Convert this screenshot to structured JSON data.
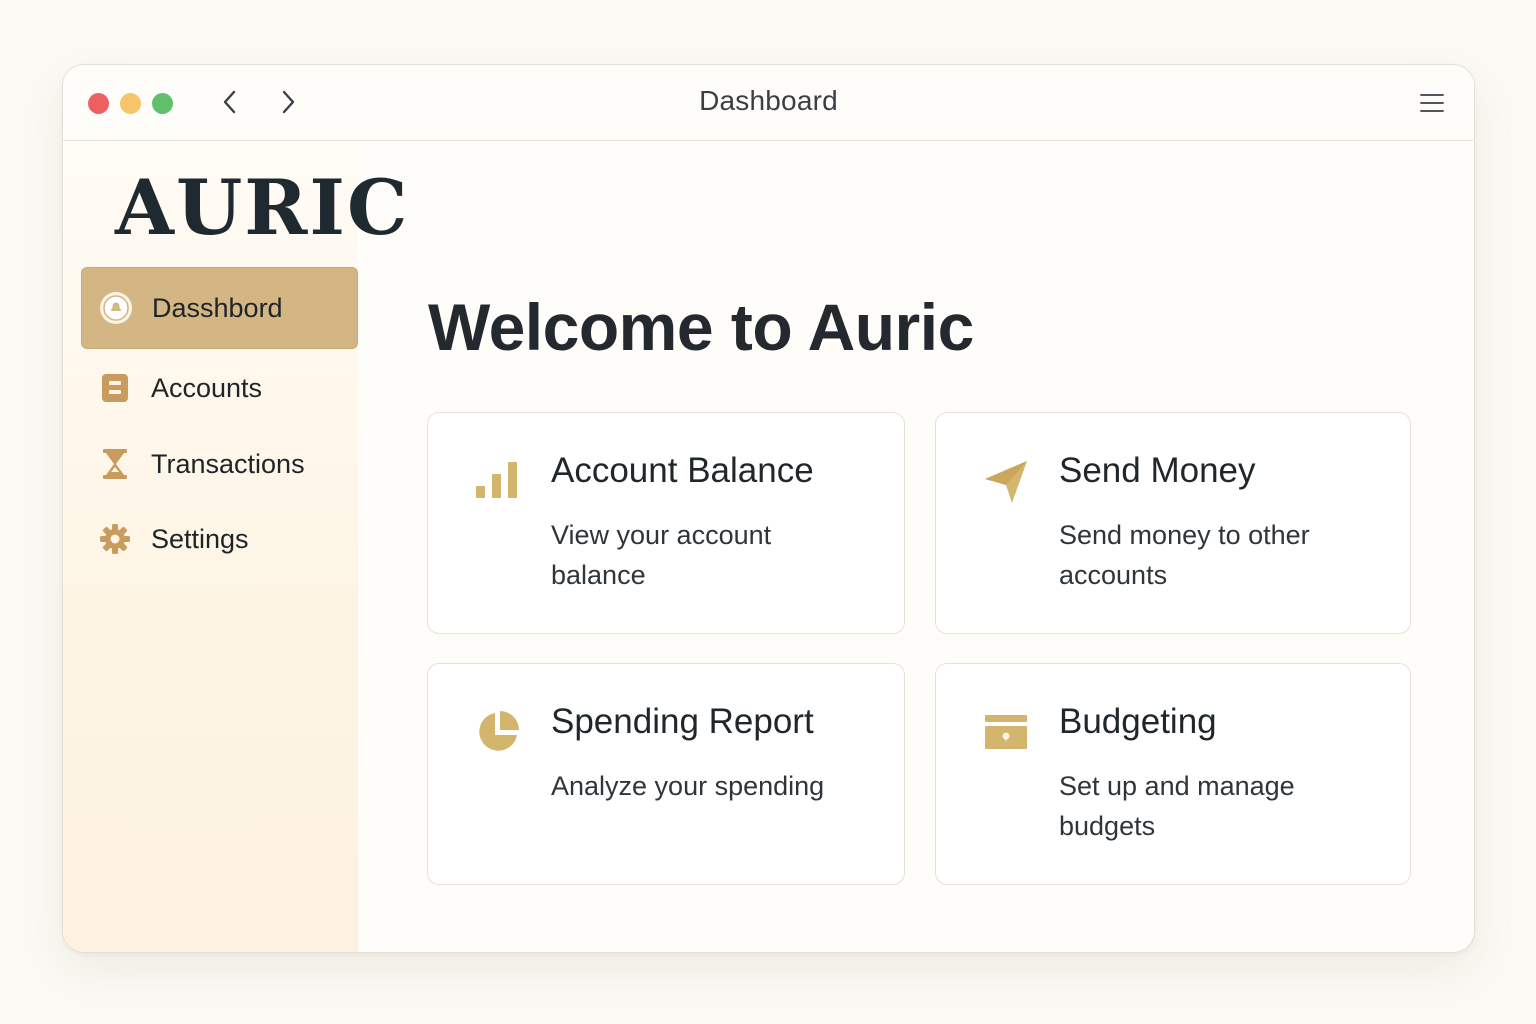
{
  "window": {
    "title": "Dashboard"
  },
  "sidebar": {
    "logo": "AURIC",
    "items": [
      {
        "label": "Dasshbord",
        "icon": "dashboard-icon",
        "active": true
      },
      {
        "label": "Accounts",
        "icon": "accounts-icon",
        "active": false
      },
      {
        "label": "Transactions",
        "icon": "hourglass-icon",
        "active": false
      },
      {
        "label": "Settings",
        "icon": "gear-icon",
        "active": false
      }
    ]
  },
  "main": {
    "title": "Welcome to Auric",
    "cards": [
      {
        "title": "Account Balance",
        "description": "View your account balance",
        "icon": "bar-chart-icon"
      },
      {
        "title": "Send Money",
        "description": "Send money to other accounts",
        "icon": "paper-plane-icon"
      },
      {
        "title": "Spending Report",
        "description": "Analyze your spending",
        "icon": "pie-chart-icon"
      },
      {
        "title": "Budgeting",
        "description": "Set up and manage budgets",
        "icon": "wallet-icon"
      }
    ]
  },
  "colors": {
    "accent": "#d3b683",
    "icon_gold": "#d4b56e",
    "text_dark": "#1f272c",
    "background": "#fcfaf5"
  }
}
